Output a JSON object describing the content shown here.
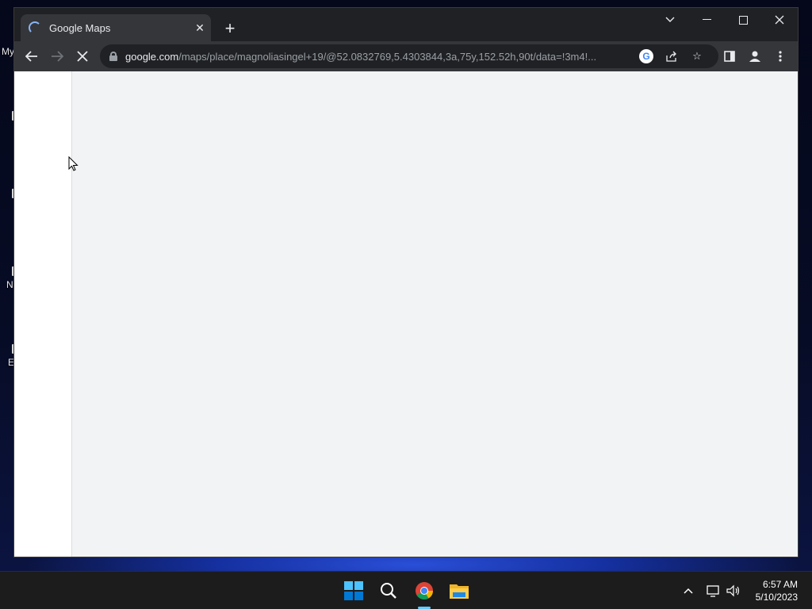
{
  "desktop": {
    "icon_labels": [
      "My",
      "N",
      "E"
    ]
  },
  "browser": {
    "tab": {
      "title": "Google Maps",
      "loading": true
    },
    "address": {
      "host": "google.com",
      "path": "/maps/place/magnoliasingel+19/@52.0832769,5.4303844,3a,75y,152.52h,90t/data=!3m4!..."
    }
  },
  "taskbar": {
    "apps": [
      "windows-start",
      "search",
      "chrome",
      "file-explorer"
    ],
    "active_app": "chrome",
    "clock": {
      "time": "6:57 AM",
      "date": "5/10/2023"
    }
  },
  "colors": {
    "tab_bg": "#35363a",
    "strip_bg": "#202124",
    "map_bg": "#f1f3f4",
    "accent": "#8ab4f8"
  }
}
